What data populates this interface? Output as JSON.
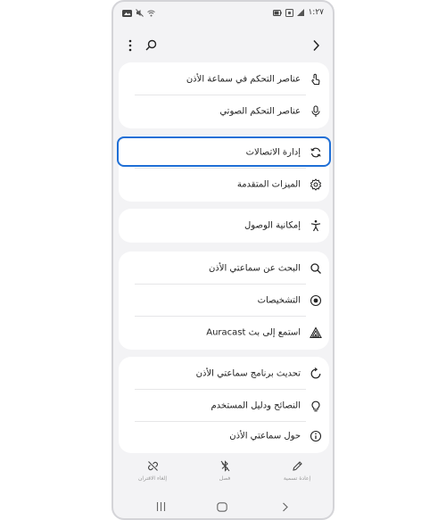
{
  "status": {
    "time": "١:٢٧",
    "left_icons": [
      "gallery-icon",
      "mute-icon",
      "wifi-off-icon"
    ],
    "right_icons": [
      "battery-icon",
      "settings-status-icon",
      "signal-icon"
    ]
  },
  "topbar": {
    "back_icon": "chevron-right-icon",
    "search_icon": "search-icon",
    "more_icon": "more-vert-icon"
  },
  "groups": [
    {
      "items": [
        {
          "label": "عناصر التحكم في سماعة الأذن",
          "icon": "touch-icon"
        },
        {
          "label": "عناصر التحكم الصوتي",
          "icon": "mic-icon"
        }
      ]
    },
    {
      "items": [
        {
          "label": "إدارة الاتصالات",
          "icon": "sync-icon",
          "highlighted": true
        },
        {
          "label": "الميزات المتقدمة",
          "icon": "gear-icon"
        }
      ]
    },
    {
      "items": [
        {
          "label": "إمكانية الوصول",
          "icon": "accessibility-icon"
        }
      ]
    },
    {
      "items": [
        {
          "label": "البحث عن سماعتي الأذن",
          "icon": "search-icon"
        },
        {
          "label": "التشخيصات",
          "icon": "diagnostics-icon"
        },
        {
          "label": "استمع إلى بث Auracast",
          "icon": "auracast-icon"
        }
      ]
    },
    {
      "items": [
        {
          "label": "تحديث برنامج سماعتي الأذن",
          "icon": "update-icon"
        },
        {
          "label": "النصائح ودليل المستخدم",
          "icon": "bulb-icon"
        },
        {
          "label": "حول سماعتي الأذن",
          "icon": "info-icon"
        }
      ]
    }
  ],
  "bottombar": {
    "rename": "إعادة تسمية",
    "disconnect": "فصل",
    "unpair": "إلغاء الاقتران"
  },
  "colors": {
    "highlight": "#1f6fd6",
    "background": "#f3f3f5",
    "card": "#ffffff"
  }
}
